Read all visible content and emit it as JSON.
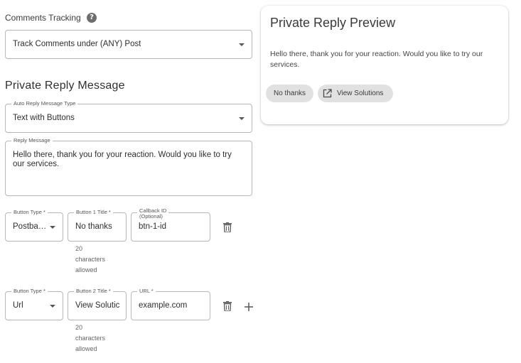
{
  "comments_tracking": {
    "label": "Comments Tracking",
    "help_icon": "help-circle-icon",
    "select_value": "Track Comments under (ANY) Post"
  },
  "private_reply": {
    "heading": "Private Reply Message",
    "type_label": "Auto Reply Message Type",
    "type_value": "Text with Buttons",
    "message_label": "Reply Message",
    "message_value": "Hello there, thank you for your reaction. Would you like to try our services."
  },
  "buttons": [
    {
      "type_label": "Button Type *",
      "type_value": "Postba…",
      "title_label": "Button 1 Title *",
      "title_value": "No thanks",
      "extra_label_line1": "Callback ID",
      "extra_label_line2": "(Optional)",
      "extra_value": "btn-1-id",
      "helper_lines": [
        "20",
        "characters",
        "allowed"
      ],
      "delete_icon": "trash-icon"
    },
    {
      "type_label": "Button Type *",
      "type_value": "Url",
      "title_label": "Button 2 Title *",
      "title_value": "View Solutic",
      "extra_label_line1": "URL *",
      "extra_value": "example.com",
      "helper_lines": [
        "20",
        "characters",
        "allowed"
      ],
      "delete_icon": "trash-icon",
      "add_icon": "plus-icon"
    }
  ],
  "preview": {
    "title": "Private Reply Preview",
    "message": "Hello there, thank you for your reaction. Would you like to try our services.",
    "chips": [
      {
        "label": "No thanks"
      },
      {
        "label": "View Solutions",
        "icon": "external-link-icon"
      }
    ]
  },
  "colors": {
    "border": "#b8b8b8",
    "chip_bg": "#e1e1e1",
    "text": "#3a3a3a"
  }
}
